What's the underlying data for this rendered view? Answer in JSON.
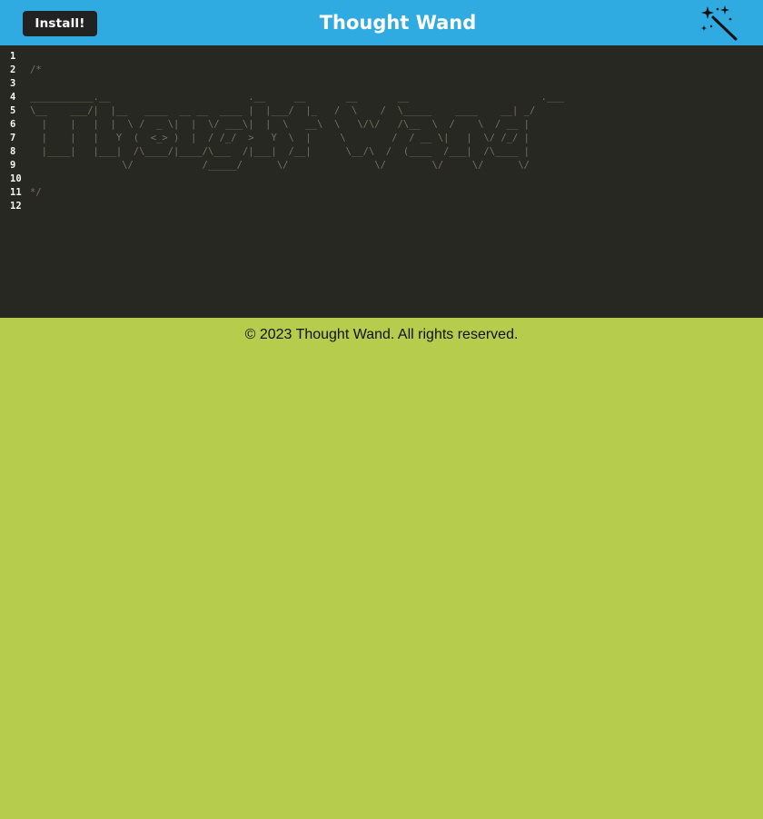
{
  "header": {
    "install_label": "Install!",
    "title": "Thought Wand",
    "icon": "magic-wand-icon"
  },
  "editor": {
    "line_numbers": [
      "1",
      "2",
      "3",
      "4",
      "5",
      "6",
      "7",
      "8",
      "9",
      "10",
      "11",
      "12"
    ],
    "lines": [
      "",
      "/*",
      "",
      "___________.__                        .__     __       __       __                       .___",
      "\\__    ___/|  |__   ____  __ __  ____ |  |___/  |_   /  \\    /  \\_____    ____    __| _/",
      "  |    |   |  |  \\ /  _ \\|  |  \\/ ___\\|  |  \\   __\\  \\   \\/\\/   /\\__  \\  /    \\  / __ |",
      "  |    |   |   Y  (  <_> )  |  / /_/  >   Y  \\  |     \\        /  / __ \\|   |  \\/ /_/ |",
      "  |____|   |___|  /\\____/|____/\\___  /|___|  /__|      \\__/\\  /  (____  /___|  /\\____ |",
      "                \\/            /_____/      \\/               \\/        \\/     \\/      \\/",
      "",
      "*/",
      ""
    ]
  },
  "footer": {
    "copyright": "© 2023 Thought Wand. All rights reserved."
  },
  "colors": {
    "header_bg": "#2fabe1",
    "editor_bg": "#272822",
    "page_bg": "#b5cc4c",
    "comment": "#75715e"
  }
}
